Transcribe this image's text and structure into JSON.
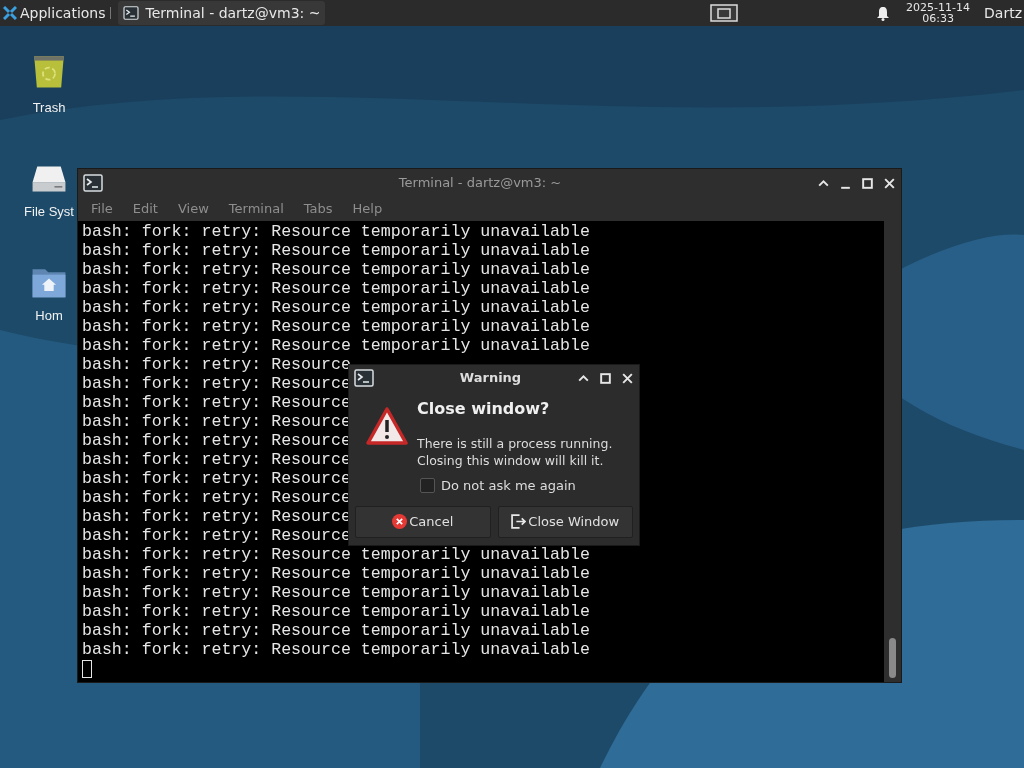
{
  "taskbar": {
    "app_menu": "Applications",
    "tasks": [
      {
        "title": "Terminal - dartz@vm3: ~",
        "selected": false
      }
    ],
    "clock": {
      "date": "2025-11-14",
      "time": "06:33"
    },
    "user": "Dartz"
  },
  "desktop_icons": [
    {
      "kind": "trash",
      "label": "Trash"
    },
    {
      "kind": "drive",
      "label": "File Syst"
    },
    {
      "kind": "home",
      "label": "Hom"
    }
  ],
  "terminal": {
    "title": "Terminal - dartz@vm3: ~",
    "menu": [
      "File",
      "Edit",
      "View",
      "Terminal",
      "Tabs",
      "Help"
    ],
    "lines": [
      "bash: fork: retry: Resource temporarily unavailable",
      "bash: fork: retry: Resource temporarily unavailable",
      "bash: fork: retry: Resource temporarily unavailable",
      "bash: fork: retry: Resource temporarily unavailable",
      "bash: fork: retry: Resource temporarily unavailable",
      "bash: fork: retry: Resource temporarily unavailable",
      "bash: fork: retry: Resource temporarily unavailable",
      "bash: fork: retry: Resource",
      "bash: fork: retry: Resource",
      "bash: fork: retry: Resource",
      "bash: fork: retry: Resource",
      "bash: fork: retry: Resource",
      "bash: fork: retry: Resource",
      "bash: fork: retry: Resource",
      "bash: fork: retry: Resource",
      "bash: fork: retry: Resource",
      "bash: fork: retry: Resource",
      "bash: fork: retry: Resource temporarily unavailable",
      "bash: fork: retry: Resource temporarily unavailable",
      "bash: fork: retry: Resource temporarily unavailable",
      "bash: fork: retry: Resource temporarily unavailable",
      "bash: fork: retry: Resource temporarily unavailable",
      "bash: fork: retry: Resource temporarily unavailable"
    ]
  },
  "dialog": {
    "title": "Warning",
    "heading": "Close window?",
    "message": "There is still a process running. Closing this window will kill it.",
    "checkbox": {
      "label": "Do not ask me again",
      "checked": false
    },
    "buttons": [
      {
        "kind": "cancel",
        "label": "Cancel"
      },
      {
        "kind": "close",
        "label": "Close Window"
      }
    ]
  }
}
